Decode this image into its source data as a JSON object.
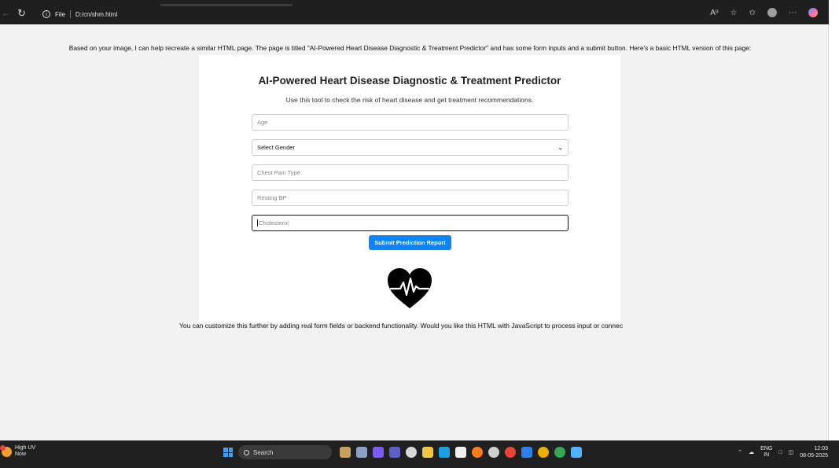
{
  "browser": {
    "file_label": "File",
    "address": "D:/cn/shm.html"
  },
  "page": {
    "intro": "Based on your image, I can help recreate a similar HTML page. The page is titled \"AI-Powered Heart Disease Diagnostic & Treatment Predictor\" and has some form inputs and a submit button. Here's a basic HTML version of this page:",
    "title": "AI-Powered Heart Disease Diagnostic & Treatment Predictor",
    "subtitle": "Use this tool to check the risk of heart disease and get treatment recommendations.",
    "fields": {
      "age_placeholder": "Age",
      "gender_selected": "Select Gender",
      "chest_pain_placeholder": "Chest Pain Type",
      "resting_bp_placeholder": "Resting BP",
      "cholesterol_placeholder": "Cholesterol"
    },
    "submit_label": "Submit Prediction Report",
    "footer": "You can customize this further by adding real form fields or backend functionality. Would you like this HTML with JavaScript to process input or connec"
  },
  "taskbar": {
    "weather_line1": "High UV",
    "weather_line2": "Now",
    "search_label": "Search",
    "lang_line1": "ENG",
    "lang_line2": "IN",
    "time": "12:03",
    "date": "08-05-2025"
  },
  "colors": {
    "accent": "#0a84ff",
    "taskbar": "#202020",
    "page_bg": "#f2f2f2"
  },
  "icons": [
    "back-icon",
    "refresh-icon",
    "info-icon",
    "read-aloud-icon",
    "favorite-icon",
    "favorites-icon",
    "profile-icon",
    "more-icon",
    "copilot-icon",
    "heart-pulse-icon",
    "windows-start-icon",
    "search-icon"
  ]
}
